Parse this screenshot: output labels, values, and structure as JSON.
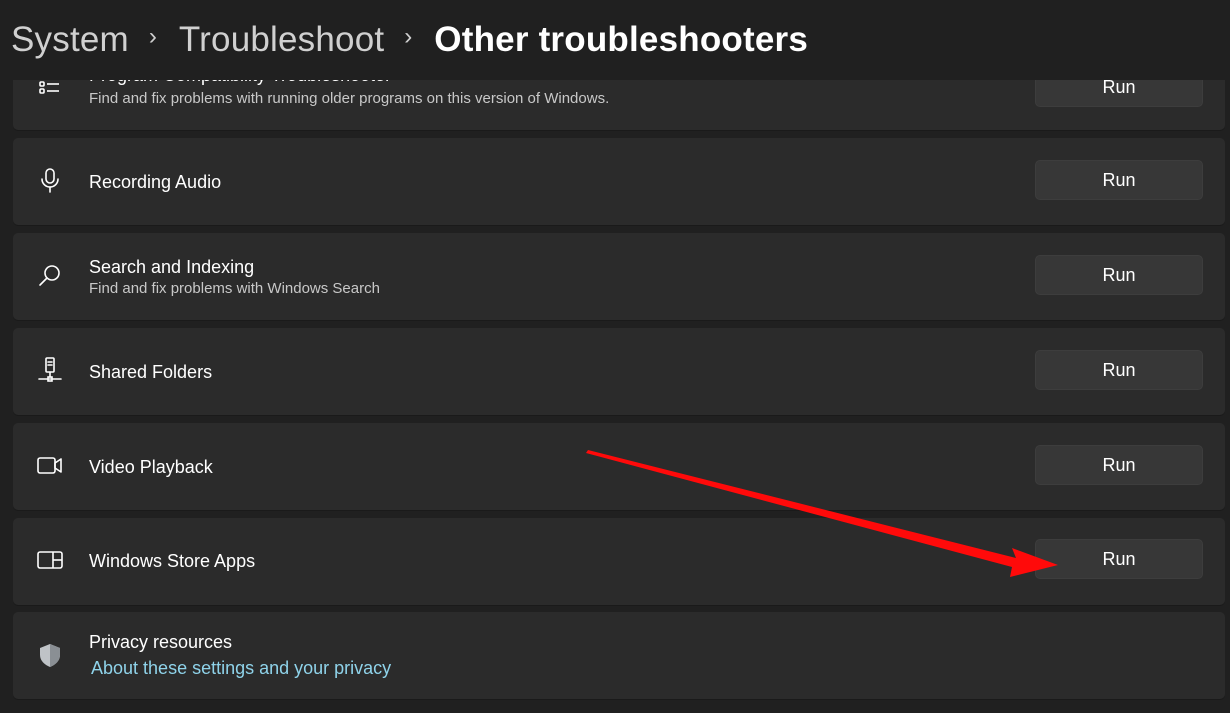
{
  "breadcrumb": {
    "items": [
      "System",
      "Troubleshoot",
      "Other troubleshooters"
    ],
    "separator": "›"
  },
  "troubleshooters": [
    {
      "icon": "list-icon",
      "title": "Program Compatibility Troubleshooter",
      "description": "Find and fix problems with running older programs on this version of Windows.",
      "button": "Run"
    },
    {
      "icon": "microphone-icon",
      "title": "Recording Audio",
      "description": "",
      "button": "Run"
    },
    {
      "icon": "search-icon",
      "title": "Search and Indexing",
      "description": "Find and fix problems with Windows Search",
      "button": "Run"
    },
    {
      "icon": "shared-folders-icon",
      "title": "Shared Folders",
      "description": "",
      "button": "Run"
    },
    {
      "icon": "video-camera-icon",
      "title": "Video Playback",
      "description": "",
      "button": "Run"
    },
    {
      "icon": "store-apps-icon",
      "title": "Windows Store Apps",
      "description": "",
      "button": "Run"
    }
  ],
  "privacy": {
    "icon": "shield-icon",
    "title": "Privacy resources",
    "link": "About these settings and your privacy"
  },
  "annotation": {
    "type": "red-arrow",
    "points_to": "Windows Store Apps Run button",
    "color": "#ff0000"
  },
  "colors": {
    "background": "#202020",
    "card": "#2b2b2b",
    "button": "#373737",
    "link": "#8fd3ea"
  }
}
